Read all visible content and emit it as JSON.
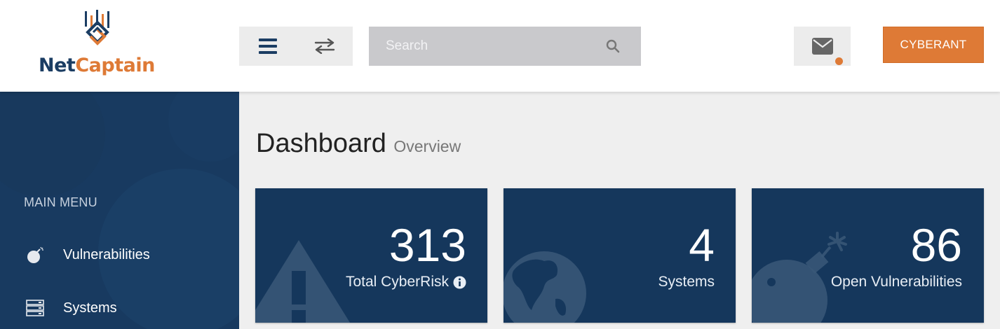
{
  "brand": {
    "name_part1": "Net",
    "name_part2": "Captain",
    "accent": "#de7a36",
    "navy": "#1b3d63"
  },
  "header": {
    "search_placeholder": "Search",
    "user_label": "CYBERANT",
    "icons": [
      "menu-icon",
      "swap-icon",
      "search-icon",
      "mail-icon"
    ]
  },
  "sidebar": {
    "title": "MAIN MENU",
    "items": [
      {
        "label": "Vulnerabilities",
        "icon": "bomb-icon"
      },
      {
        "label": "Systems",
        "icon": "server-icon"
      }
    ]
  },
  "page": {
    "title": "Dashboard",
    "subtitle": "Overview"
  },
  "cards": [
    {
      "value": "313",
      "label": "Total CyberRisk",
      "icon": "warning-icon"
    },
    {
      "value": "4",
      "label": "Systems",
      "icon": "globe-icon"
    },
    {
      "value": "86",
      "label": "Open Vulnerabilities",
      "icon": "bomb-icon"
    }
  ]
}
